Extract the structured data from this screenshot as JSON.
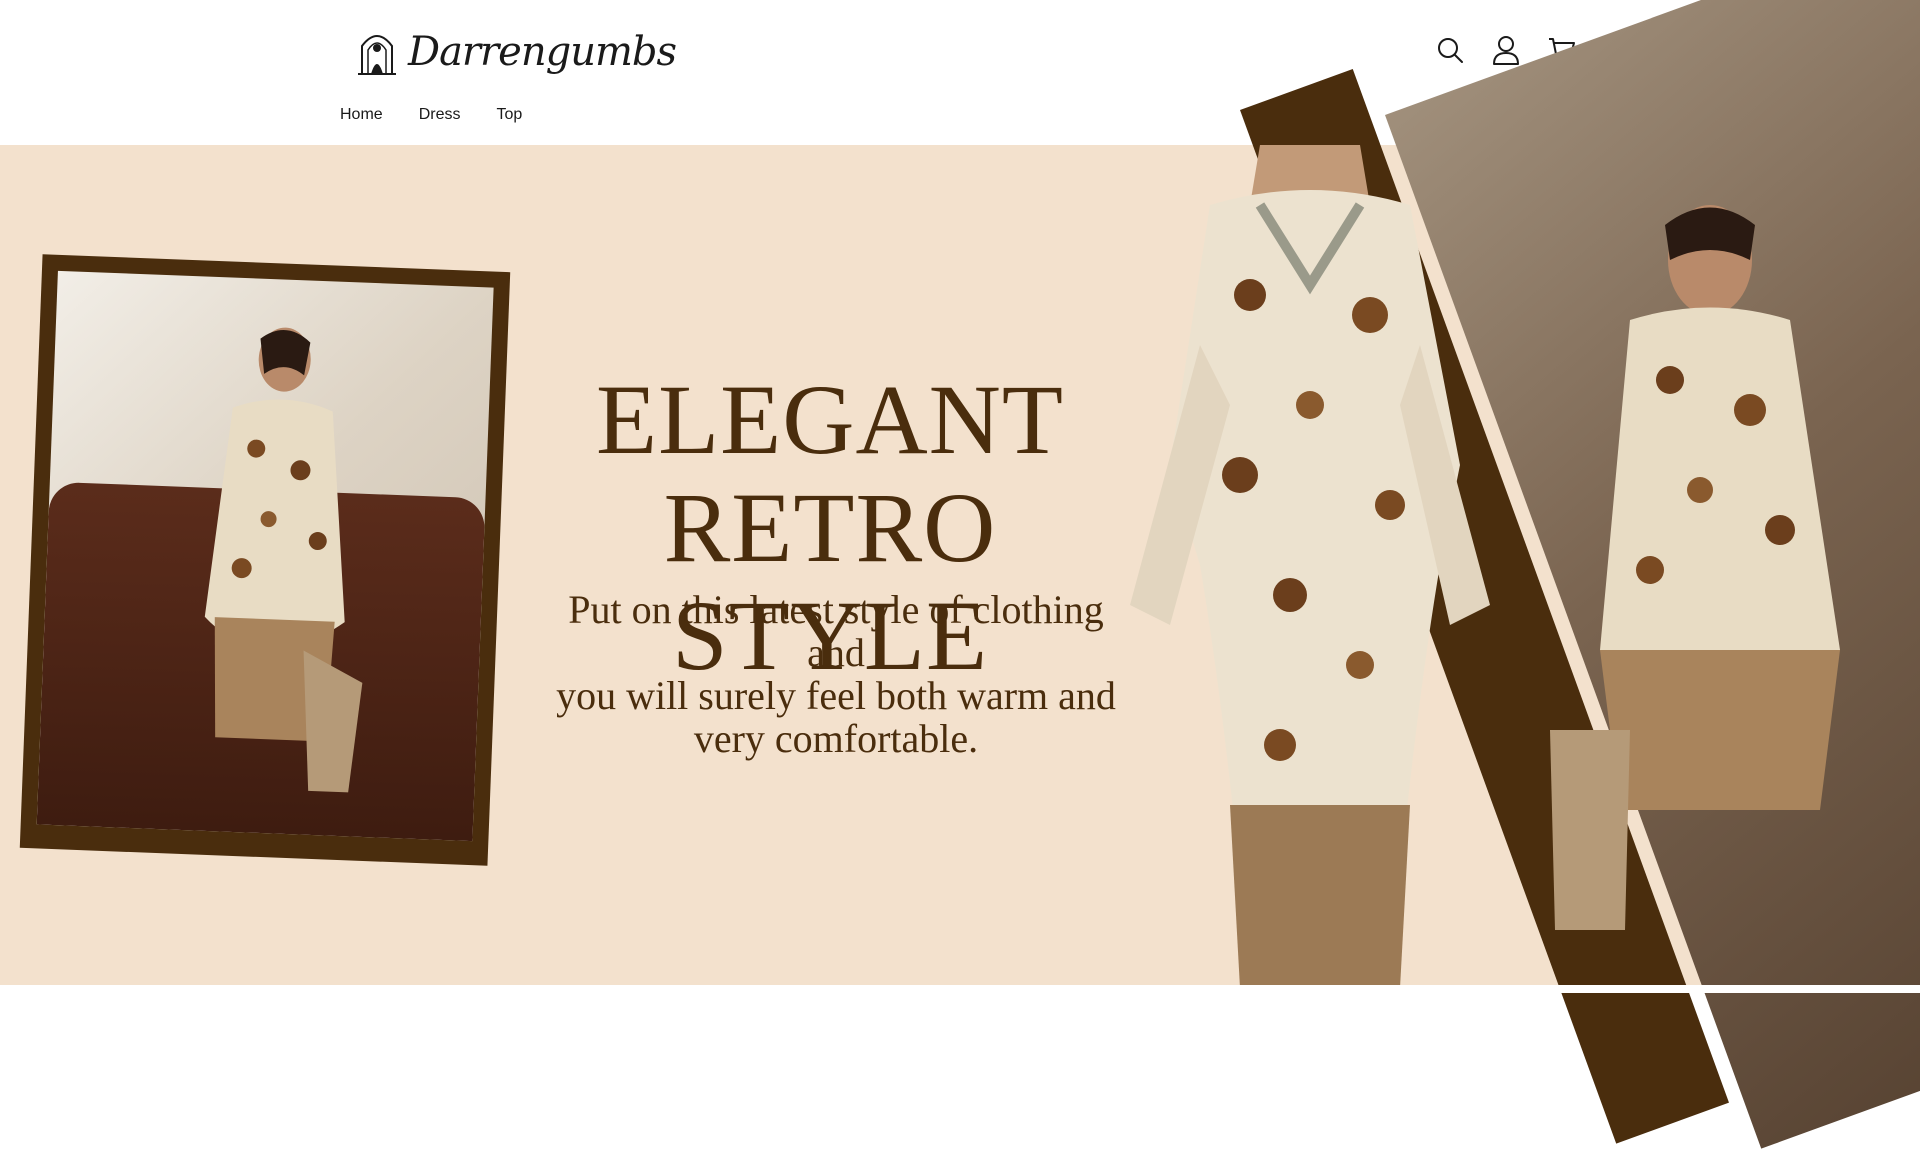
{
  "header": {
    "brand": "Darrengumbs",
    "icons": [
      "search-icon",
      "account-icon",
      "cart-icon"
    ]
  },
  "nav": {
    "items": [
      {
        "label": "Home"
      },
      {
        "label": "Dress"
      },
      {
        "label": "Top"
      }
    ]
  },
  "hero": {
    "headline_line1": "ELEGANT",
    "headline_line2": "RETRO STYLE",
    "subtitle_line1": "Put on this latest style of clothing and",
    "subtitle_line2": "you will surely feel both warm and",
    "subtitle_line3": "very comfortable."
  },
  "colors": {
    "accent": "#4a2d0d",
    "hero_background": "#f3e1cd",
    "text": "#1a1a1a"
  }
}
